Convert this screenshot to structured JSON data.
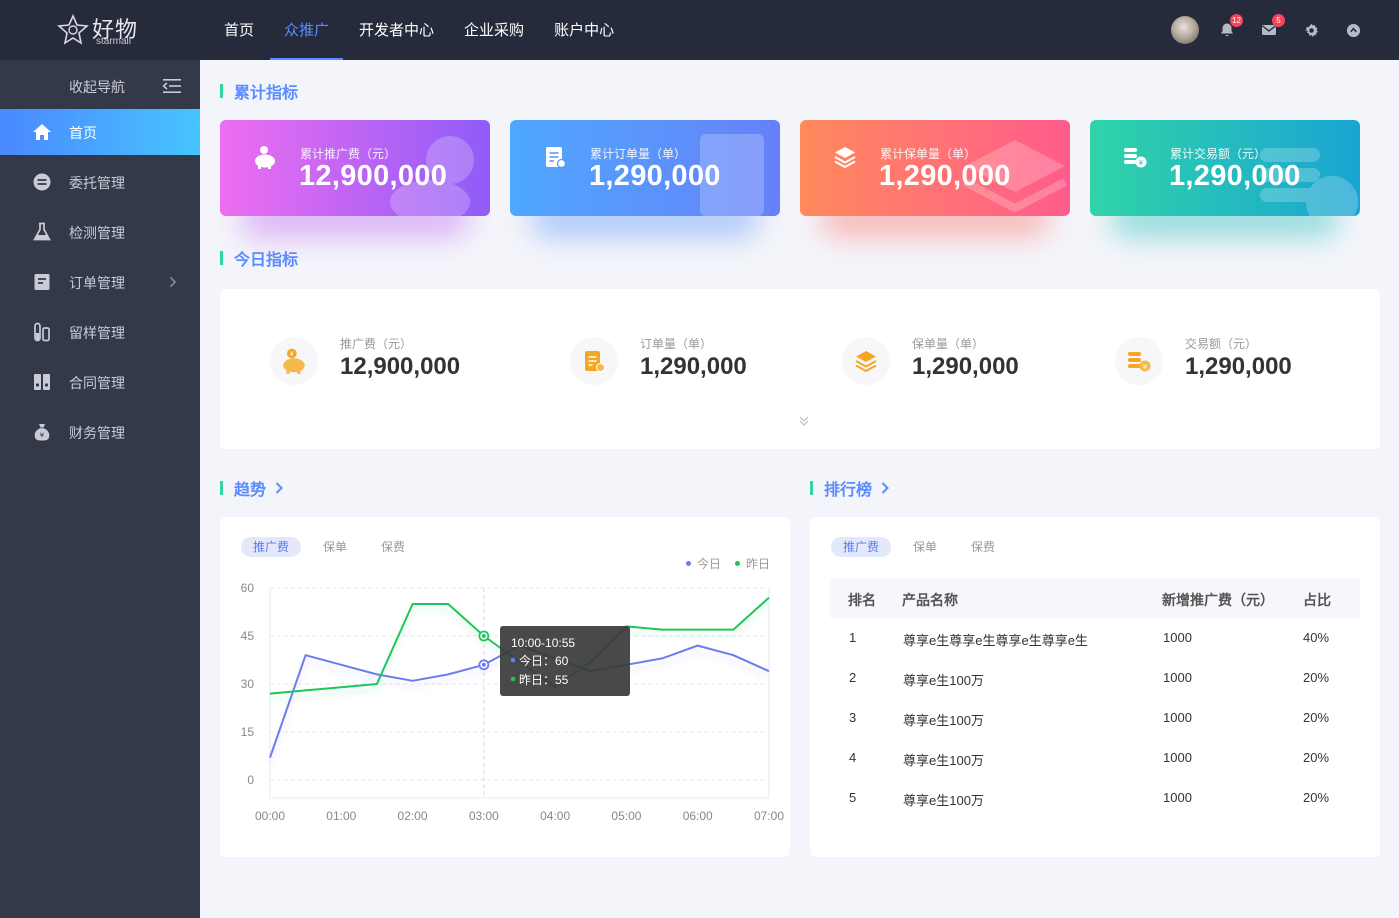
{
  "brand": {
    "name_cn": "好物",
    "name_en": "starmall"
  },
  "nav": [
    {
      "label": "首页",
      "active": false
    },
    {
      "label": "众推广",
      "active": true
    },
    {
      "label": "开发者中心",
      "active": false
    },
    {
      "label": "企业采购",
      "active": false
    },
    {
      "label": "账户中心",
      "active": false
    }
  ],
  "header_icons": {
    "bell_badge": "12",
    "mail_badge": "5"
  },
  "sidebar": {
    "collapse_label": "收起导航",
    "items": [
      {
        "label": "首页",
        "icon": "home-icon",
        "active": true
      },
      {
        "label": "委托管理",
        "icon": "entrust-icon",
        "active": false
      },
      {
        "label": "检测管理",
        "icon": "flask-icon",
        "active": false
      },
      {
        "label": "订单管理",
        "icon": "order-icon",
        "active": false,
        "has_children": true
      },
      {
        "label": "留样管理",
        "icon": "sample-tube-icon",
        "active": false
      },
      {
        "label": "合同管理",
        "icon": "contract-icon",
        "active": false
      },
      {
        "label": "财务管理",
        "icon": "money-bag-icon",
        "active": false
      }
    ]
  },
  "sections": {
    "cumulative": "累计指标",
    "today": "今日指标",
    "trend": "趋势",
    "ranking": "排行榜"
  },
  "kpis": [
    {
      "label": "累计推广费（元）",
      "value": "12,900,000",
      "icon": "piggy-bank-icon",
      "color_from": "#ed6ef0",
      "color_to": "#8f5cf7"
    },
    {
      "label": "累计订单量（单）",
      "value": "1,290,000",
      "icon": "clipboard-icon",
      "color_from": "#4fa8ff",
      "color_to": "#6780f8"
    },
    {
      "label": "累计保单量（单）",
      "value": "1,290,000",
      "icon": "layers-icon",
      "color_from": "#ff8a5c",
      "color_to": "#ff5c8c"
    },
    {
      "label": "累计交易额（元）",
      "value": "1,290,000",
      "icon": "coins-icon",
      "color_from": "#30d4a8",
      "color_to": "#1aa4d4"
    }
  ],
  "today": [
    {
      "label": "推广费（元）",
      "value": "12,900,000",
      "icon": "piggy-bank-icon"
    },
    {
      "label": "订单量（单）",
      "value": "1,290,000",
      "icon": "clipboard-icon"
    },
    {
      "label": "保单量（单）",
      "value": "1,290,000",
      "icon": "layers-icon"
    },
    {
      "label": "交易额（元）",
      "value": "1,290,000",
      "icon": "coins-icon"
    }
  ],
  "trend_tabs": [
    "推广费",
    "保单",
    "保费"
  ],
  "trend_legend": {
    "today": "今日",
    "yesterday": "昨日"
  },
  "tooltip": {
    "title": "10:00-10:55",
    "today": "今日：60",
    "yesterday": "昨日：55"
  },
  "chart_data": {
    "type": "line",
    "x": [
      "00:00",
      "00:30",
      "01:00",
      "01:30",
      "02:00",
      "02:30",
      "03:00",
      "03:30",
      "04:00",
      "04:30",
      "05:00",
      "05:30",
      "06:00",
      "06:30",
      "07:00"
    ],
    "x_ticks": [
      "00:00",
      "01:00",
      "02:00",
      "03:00",
      "04:00",
      "05:00",
      "06:00",
      "07:00"
    ],
    "y_ticks": [
      0,
      15,
      30,
      45,
      60
    ],
    "ylim": [
      0,
      60
    ],
    "series": [
      {
        "name": "今日",
        "color": "#6a7cf0",
        "values": [
          7,
          39,
          36,
          33,
          31,
          33,
          36,
          42,
          38,
          34,
          36,
          38,
          42,
          39,
          34
        ]
      },
      {
        "name": "昨日",
        "color": "#1fc65c",
        "values": [
          27,
          28,
          29,
          30,
          55,
          55,
          45,
          37,
          29,
          37,
          48,
          47,
          47,
          47,
          57
        ]
      }
    ],
    "highlight_index": 6
  },
  "rank_tabs": [
    "推广费",
    "保单",
    "保费"
  ],
  "rank_headers": [
    "排名",
    "产品名称",
    "新增推广费（元）",
    "占比"
  ],
  "rank_rows": [
    [
      "1",
      "尊享e生尊享e生尊享e生尊享e生",
      "1000",
      "40%"
    ],
    [
      "2",
      "尊享e生100万",
      "1000",
      "20%"
    ],
    [
      "3",
      "尊享e生100万",
      "1000",
      "20%"
    ],
    [
      "4",
      "尊享e生100万",
      "1000",
      "20%"
    ],
    [
      "5",
      "尊享e生100万",
      "1000",
      "20%"
    ]
  ]
}
